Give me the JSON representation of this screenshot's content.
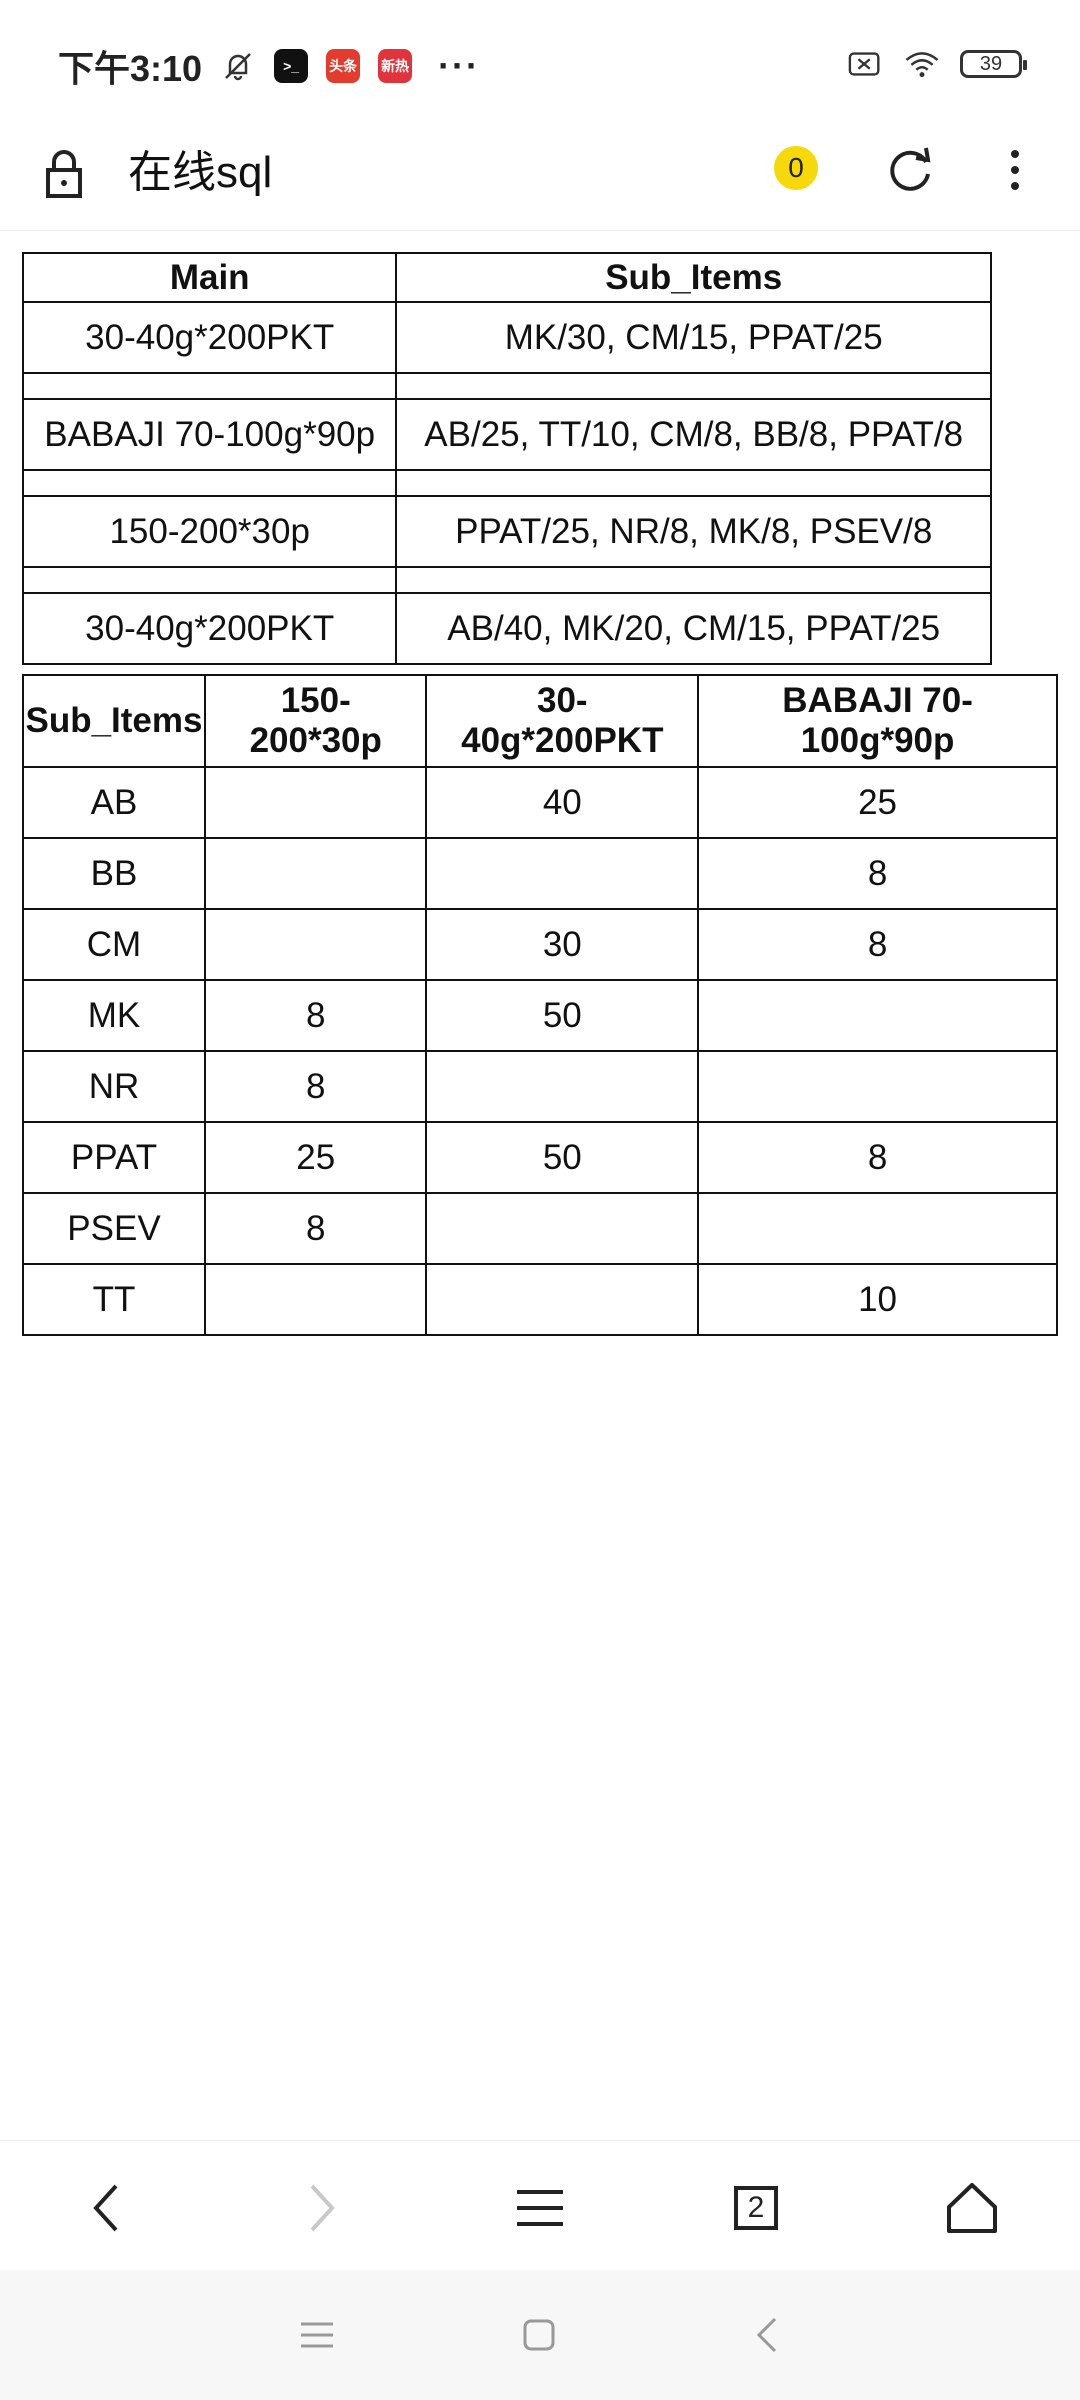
{
  "status_bar": {
    "time": "下午3:10",
    "battery": "39",
    "apps": [
      {
        "name": "terminal",
        "label": ">_",
        "color": "#111111"
      },
      {
        "name": "toutiao",
        "label": "头条",
        "color": "#e33b2e"
      },
      {
        "name": "xinre",
        "label": "新热",
        "color": "#e0343c"
      }
    ],
    "more": "···"
  },
  "address_bar": {
    "title": "在线sql",
    "counter": "0"
  },
  "table_main": {
    "headers": [
      "Main",
      "Sub_Items"
    ],
    "rows": [
      {
        "main": "30-40g*200PKT",
        "sub": "MK/30, CM/15, PPAT/25"
      },
      {
        "main": "BABAJI 70-100g*90p",
        "sub": "AB/25, TT/10, CM/8, BB/8, PPAT/8"
      },
      {
        "main": "150-200*30p",
        "sub": "PPAT/25, NR/8, MK/8, PSEV/8"
      },
      {
        "main": "30-40g*200PKT",
        "sub": "AB/40, MK/20, CM/15, PPAT/25"
      }
    ]
  },
  "table_pivot": {
    "headers": [
      "Sub_Items",
      "150-\n200*30p",
      "30-\n40g*200PKT",
      "BABAJI 70-\n100g*90p"
    ],
    "rows": [
      {
        "item": "AB",
        "c1": "",
        "c2": "40",
        "c3": "25"
      },
      {
        "item": "BB",
        "c1": "",
        "c2": "",
        "c3": "8"
      },
      {
        "item": "CM",
        "c1": "",
        "c2": "30",
        "c3": "8"
      },
      {
        "item": "MK",
        "c1": "8",
        "c2": "50",
        "c3": ""
      },
      {
        "item": "NR",
        "c1": "8",
        "c2": "",
        "c3": ""
      },
      {
        "item": "PPAT",
        "c1": "25",
        "c2": "50",
        "c3": "8"
      },
      {
        "item": "PSEV",
        "c1": "8",
        "c2": "",
        "c3": ""
      },
      {
        "item": "TT",
        "c1": "",
        "c2": "",
        "c3": "10"
      }
    ]
  },
  "toolbar": {
    "tabs_count": "2",
    "icons": [
      "back-icon",
      "forward-icon",
      "menu-icon",
      "tabs-icon",
      "home-icon"
    ]
  },
  "system_nav": {
    "icons": [
      "recents-icon",
      "home-square-icon",
      "system-back-icon"
    ]
  }
}
